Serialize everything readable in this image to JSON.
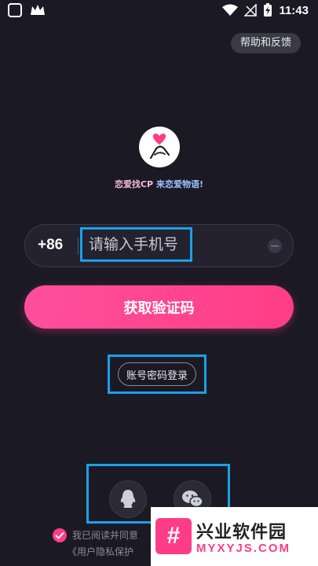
{
  "status_bar": {
    "time": "11:43"
  },
  "header": {
    "help_label": "帮助和反馈"
  },
  "slogan": {
    "part1": "恋爱找CP",
    "part2": "来恋爱物语!"
  },
  "login": {
    "country_code": "+86",
    "phone_placeholder": "请输入手机号",
    "get_code_label": "获取验证码",
    "account_login_label": "账号密码登录"
  },
  "social": {
    "items": [
      "qq-icon",
      "wechat-icon"
    ]
  },
  "agreement": {
    "text": "我已阅读并同意",
    "policy_link": "《用户隐私保护"
  },
  "watermark": {
    "logo_text": "#",
    "title": "兴业软件园",
    "url": "MYXYJS.COM"
  },
  "colors": {
    "accent": "#ff3d86",
    "background": "#1b1a24",
    "highlight": "#1aa1e8"
  }
}
